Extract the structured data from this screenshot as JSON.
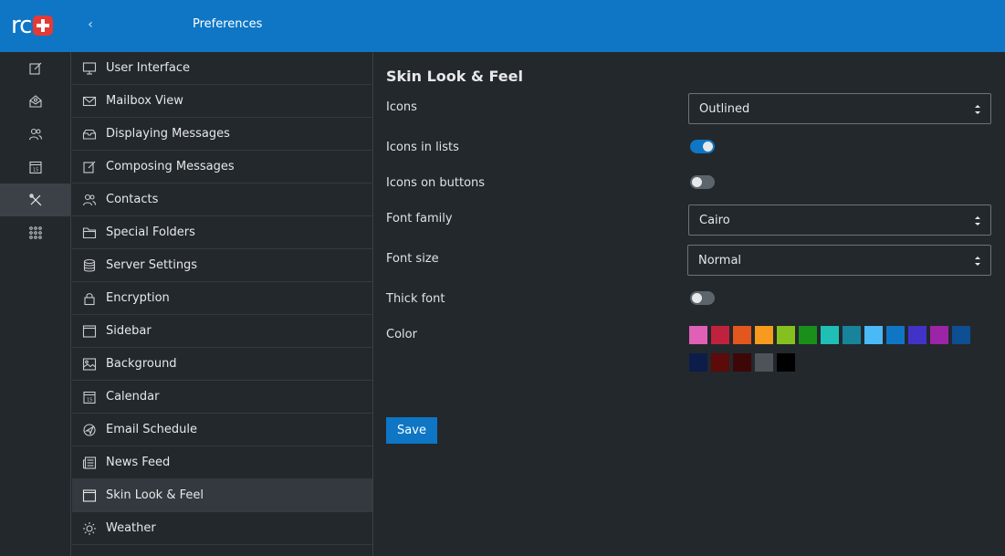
{
  "header": {
    "logo_text": "rc",
    "back_glyph": "‹",
    "title": "Preferences"
  },
  "rail": {
    "items": [
      {
        "icon": "compose-icon"
      },
      {
        "icon": "mail-icon"
      },
      {
        "icon": "contacts-icon"
      },
      {
        "icon": "calendar-icon"
      },
      {
        "icon": "settings-tools-icon",
        "active": true
      },
      {
        "icon": "apps-grid-icon"
      }
    ]
  },
  "list": {
    "items": [
      {
        "label": "User Interface",
        "icon": "monitor-icon"
      },
      {
        "label": "Mailbox View",
        "icon": "envelope-icon"
      },
      {
        "label": "Displaying Messages",
        "icon": "envelope-open-icon"
      },
      {
        "label": "Composing Messages",
        "icon": "compose-icon"
      },
      {
        "label": "Contacts",
        "icon": "contacts-icon"
      },
      {
        "label": "Special Folders",
        "icon": "folder-icon"
      },
      {
        "label": "Server Settings",
        "icon": "database-icon"
      },
      {
        "label": "Encryption",
        "icon": "lock-icon"
      },
      {
        "label": "Sidebar",
        "icon": "window-icon"
      },
      {
        "label": "Background",
        "icon": "image-icon"
      },
      {
        "label": "Calendar",
        "icon": "calendar-icon"
      },
      {
        "label": "Email Schedule",
        "icon": "schedule-icon"
      },
      {
        "label": "News Feed",
        "icon": "newspaper-icon"
      },
      {
        "label": "Skin Look & Feel",
        "icon": "window-icon",
        "active": true
      },
      {
        "label": "Weather",
        "icon": "sun-icon"
      }
    ]
  },
  "main": {
    "title": "Skin Look & Feel",
    "icons_label": "Icons",
    "icons_value": "Outlined",
    "icons_in_lists_label": "Icons in lists",
    "icons_in_lists_on": true,
    "icons_on_buttons_label": "Icons on buttons",
    "icons_on_buttons_on": false,
    "font_family_label": "Font family",
    "font_family_value": "Cairo",
    "font_size_label": "Font size",
    "font_size_value": "Normal",
    "thick_font_label": "Thick font",
    "thick_font_on": false,
    "color_label": "Color",
    "colors": [
      "#e060b6",
      "#c0223d",
      "#e2571e",
      "#f79a1e",
      "#86c01e",
      "#1a8f1a",
      "#1fbfb5",
      "#17849b",
      "#4bb9f5",
      "#0e76c5",
      "#4233c8",
      "#9b25a6",
      "#0d4f92",
      "#0c1d4a",
      "#5c0a0a",
      "#3d0707",
      "#4e5359",
      "#000000"
    ],
    "save_label": "Save"
  },
  "theme": {
    "accent": "#0e76c5",
    "background": "#23282c",
    "active_row": "#33393e"
  }
}
